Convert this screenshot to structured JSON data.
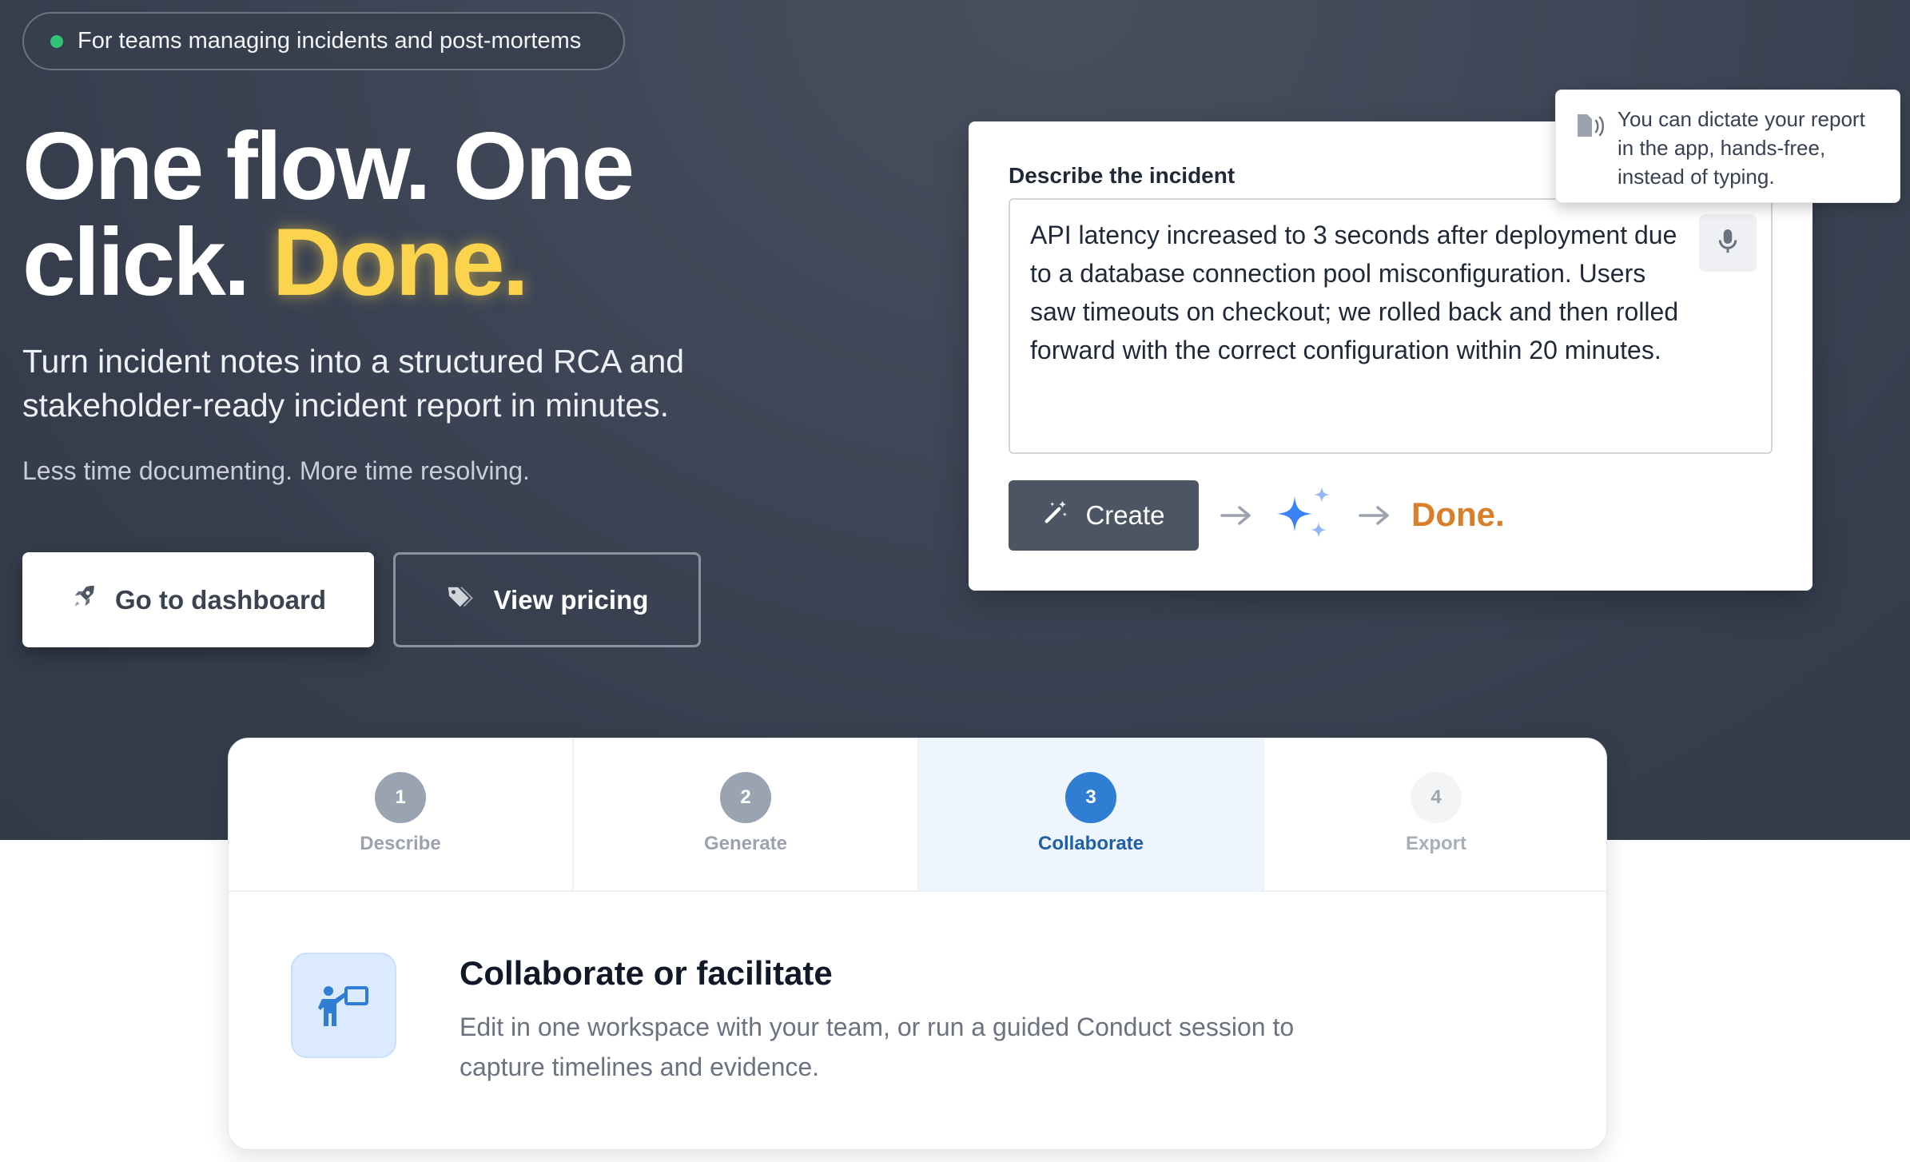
{
  "hero": {
    "badge": "For teams managing incidents and post-mortems",
    "headline_line1": "One flow. One",
    "headline_line2_pre": "click.",
    "headline_highlight": "Done.",
    "subtitle": "Turn incident notes into a structured RCA and stakeholder-ready incident report in minutes.",
    "tagline": "Less time documenting. More time resolving.",
    "primary_button": "Go to dashboard",
    "secondary_button": "View pricing"
  },
  "demo": {
    "field_label": "Describe the incident",
    "textarea_value": "API latency increased to 3 seconds after deployment due to a database connection pool misconfiguration. Users saw timeouts on checkout; we rolled back and then rolled forward with the correct configuration within 20 minutes.",
    "create_button": "Create",
    "done_label": "Done.",
    "tooltip": "You can dictate your report in the app, hands-free, instead of typing."
  },
  "steps": [
    {
      "number": "1",
      "label": "Describe",
      "state": "done"
    },
    {
      "number": "2",
      "label": "Generate",
      "state": "done"
    },
    {
      "number": "3",
      "label": "Collaborate",
      "state": "active"
    },
    {
      "number": "4",
      "label": "Export",
      "state": "todo"
    }
  ],
  "step_detail": {
    "title": "Collaborate or facilitate",
    "description": "Edit in one workspace with your team, or run a guided Conduct session to capture timelines and evidence."
  },
  "colors": {
    "accent_yellow": "#fcd34d",
    "done_orange": "#d97f2a",
    "active_blue": "#2f7ed3",
    "status_green": "#34c178",
    "hero_background": "#3a4253"
  },
  "icons": {
    "badge": "status-dot-icon",
    "primary_button": "rocket-icon",
    "secondary_button": "tag-icon",
    "mic": "microphone-icon",
    "create": "magic-wand-icon",
    "ai": "sparkles-icon",
    "tooltip": "voice-speaker-icon",
    "step_detail": "presenter-icon"
  }
}
